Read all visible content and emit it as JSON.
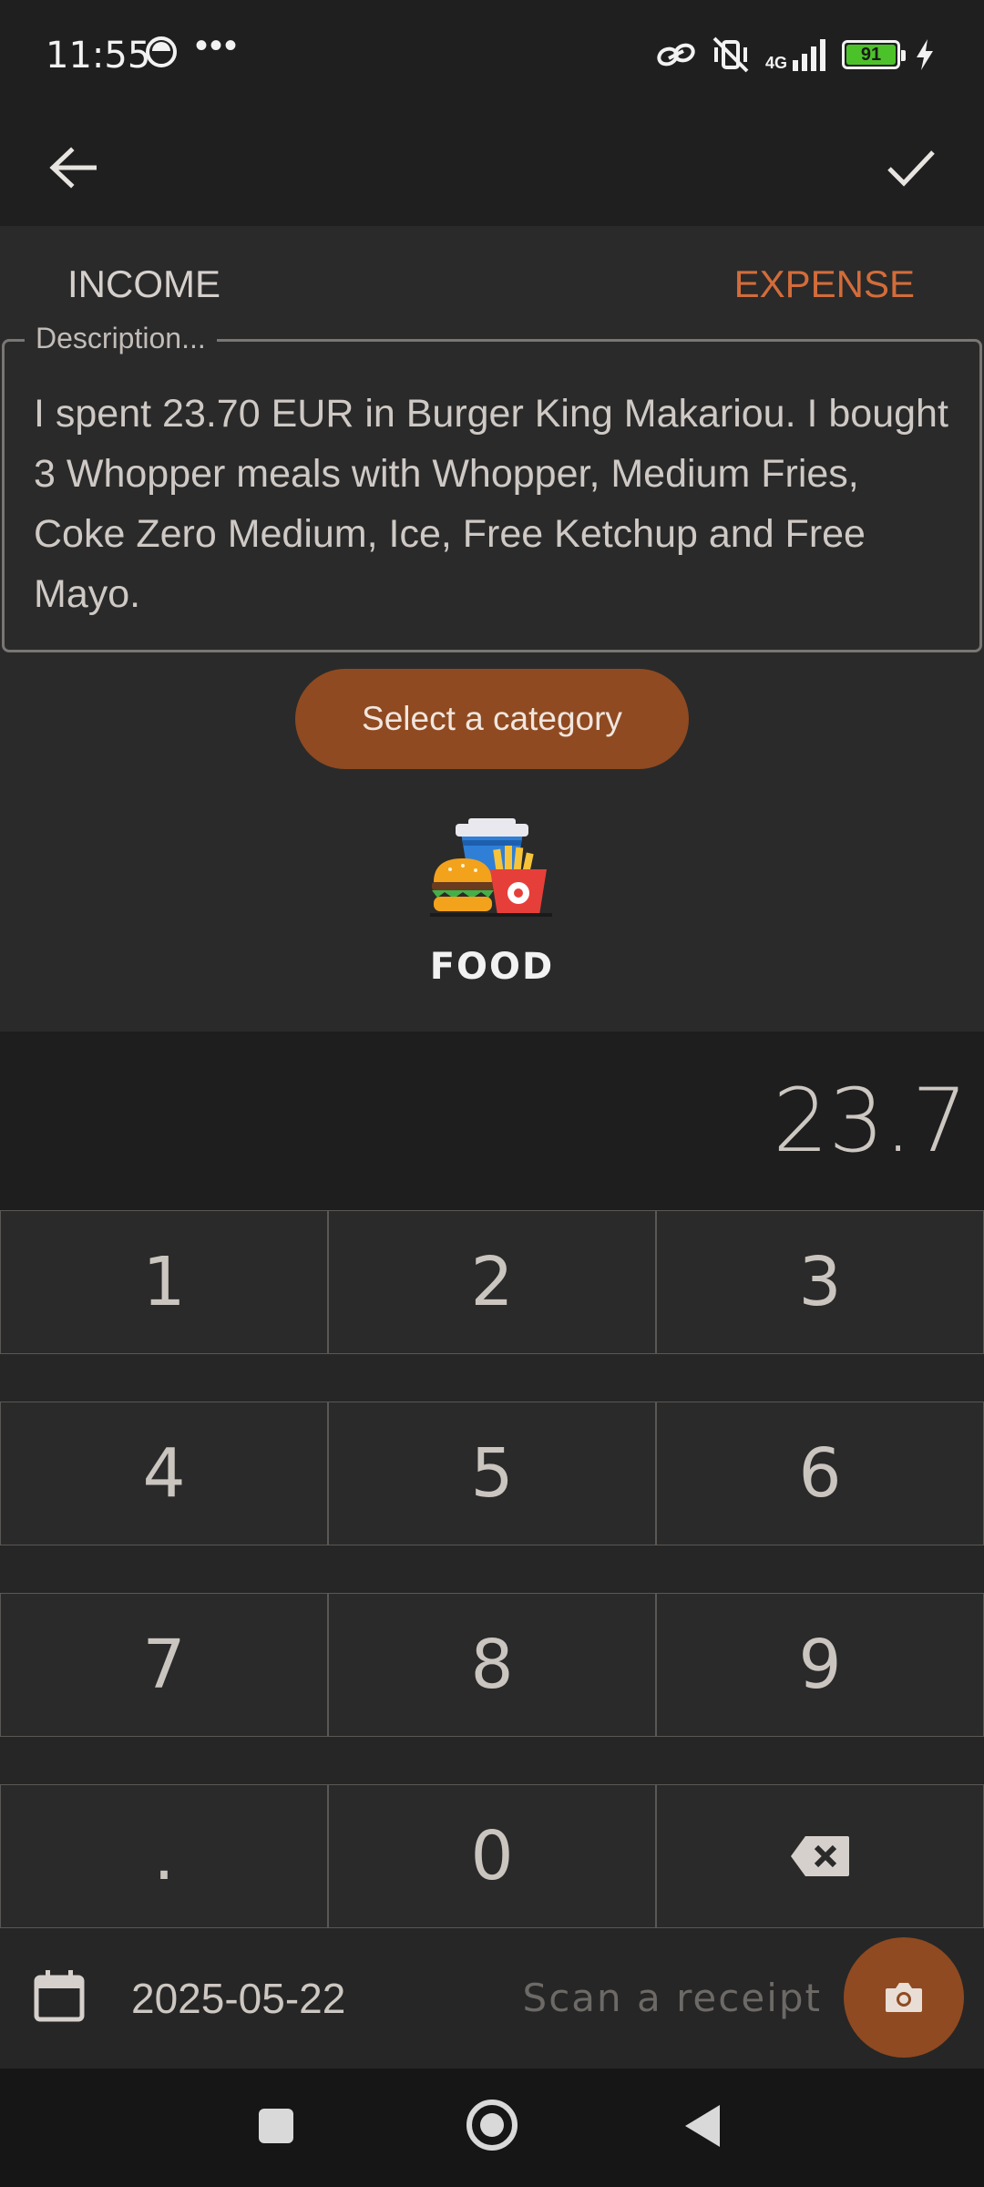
{
  "status_bar": {
    "time": "11:55",
    "dots": "•••",
    "network": "4G",
    "battery": "91",
    "icons": [
      "face-icon",
      "link-icon",
      "vibrate-off-icon",
      "signal-icon",
      "battery-icon",
      "charging-icon"
    ]
  },
  "app_bar": {
    "back_icon": "arrow-left-icon",
    "confirm_icon": "check-icon"
  },
  "type_toggle": {
    "income_label": "INCOME",
    "expense_label": "EXPENSE",
    "selected": "EXPENSE",
    "accent_color": "#d36c3a"
  },
  "description": {
    "label": "Description...",
    "value": "I spent 23.70 EUR in Burger King Makariou. I bought 3 Whopper meals with Whopper, Medium Fries, Coke Zero Medium, Ice, Free Ketchup and Free Mayo."
  },
  "category": {
    "button_label": "Select a category",
    "selected_name": "FOOD",
    "selected_icon": "fast-food-icon",
    "button_color": "#8f4a21"
  },
  "amount": {
    "value": "23.7"
  },
  "keypad": {
    "rows": [
      [
        "1",
        "2",
        "3"
      ],
      [
        "4",
        "5",
        "6"
      ],
      [
        "7",
        "8",
        "9"
      ],
      [
        ".",
        "0",
        ""
      ]
    ],
    "backspace_icon": "backspace-icon"
  },
  "footer": {
    "date": "2025-05-22",
    "calendar_icon": "calendar-icon",
    "scan_label": "Scan a receipt",
    "camera_icon": "camera-icon"
  },
  "nav_bar": {
    "icons": [
      "recents-icon",
      "home-icon",
      "back-icon"
    ]
  }
}
